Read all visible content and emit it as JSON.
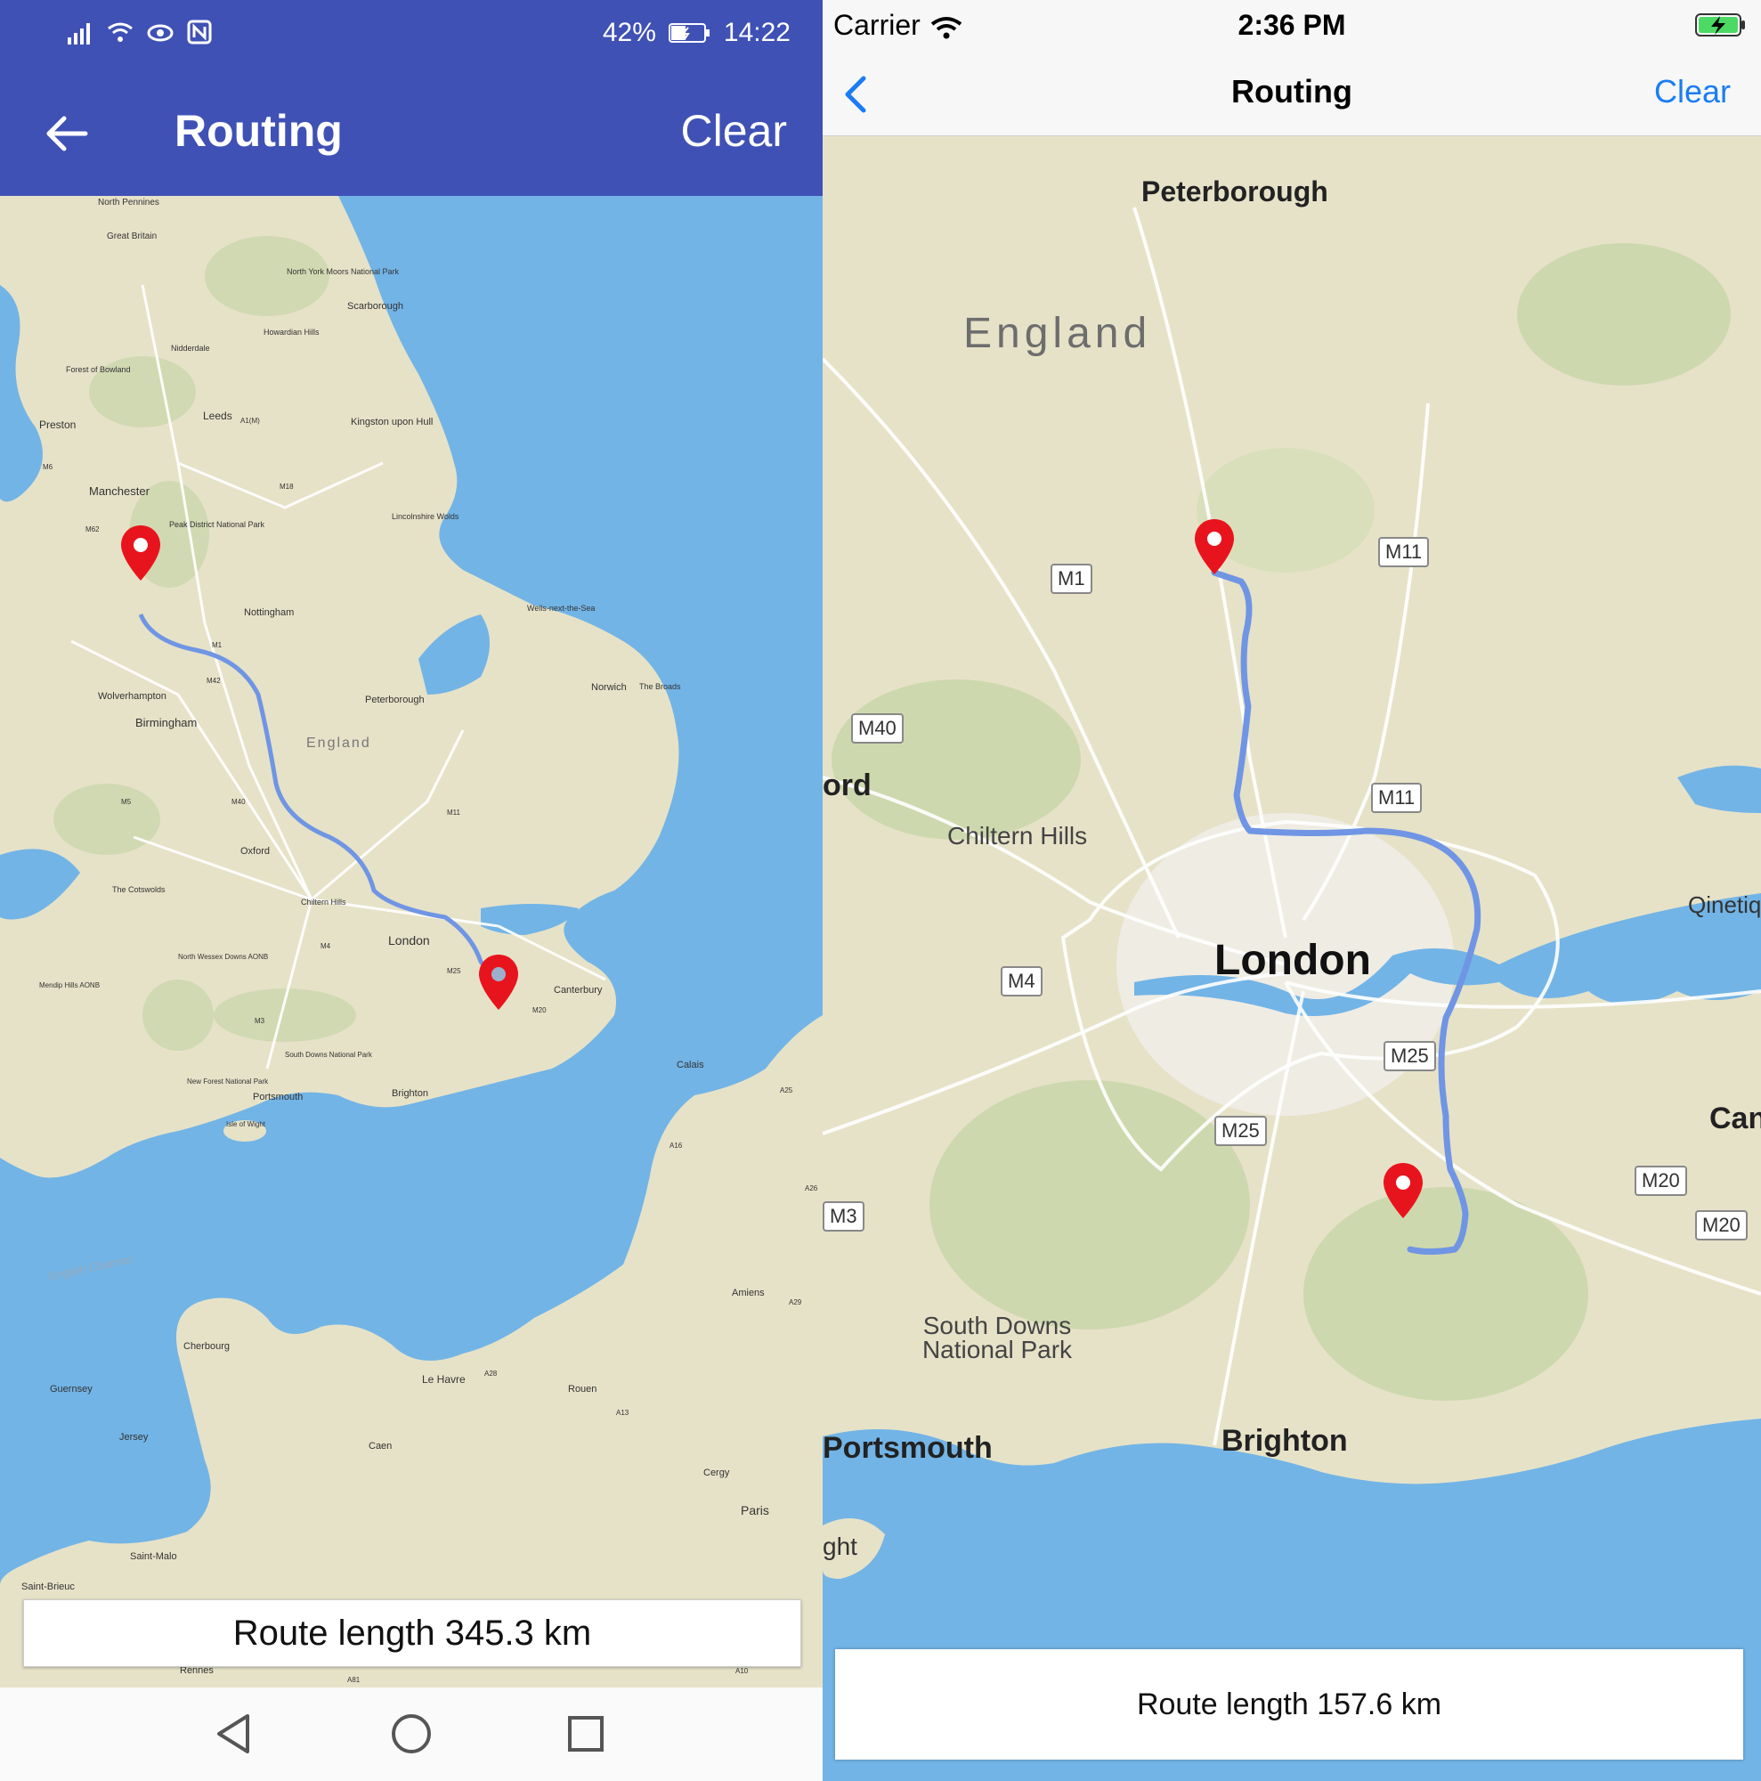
{
  "android": {
    "status": {
      "battery_pct": "42%",
      "time": "14:22"
    },
    "toolbar": {
      "title": "Routing",
      "clear_label": "Clear"
    },
    "route_length": "Route length 345.3 km",
    "map": {
      "places": [
        "North Pennines",
        "Great Britain",
        "North York Moors National Park",
        "Scarborough",
        "Howardian Hills",
        "Nidderdale",
        "Forest of Bowland",
        "Preston",
        "Leeds",
        "Kingston upon Hull",
        "Manchester",
        "Peak District National Park",
        "Lincolnshire Wolds",
        "Nottingham",
        "Wells-next-the-Sea",
        "Norwich",
        "The Broads",
        "Wolverhampton",
        "Birmingham",
        "Peterborough",
        "England",
        "Oxford",
        "The Cotswolds",
        "Chiltern Hills",
        "London",
        "North Wessex Downs AONB",
        "Mendip Hills AONB",
        "Canterbury",
        "South Downs National Park",
        "New Forest National Park",
        "Portsmouth",
        "Brighton",
        "Isle of Wight",
        "Calais",
        "English Channel",
        "Amiens",
        "Cherbourg",
        "Guernsey",
        "Jersey",
        "Le Havre",
        "Rouen",
        "Caen",
        "Cergy",
        "Paris",
        "Saint-Malo",
        "Saint-Brieuc",
        "Rennes"
      ],
      "roads": [
        "M6",
        "M62",
        "A1(M)",
        "M18",
        "M1",
        "M42",
        "M5",
        "M40",
        "M11",
        "M4",
        "M25",
        "M20",
        "M3",
        "A16",
        "A26",
        "A25",
        "A29",
        "A28",
        "A13",
        "A81",
        "A10"
      ]
    },
    "nav": {
      "icons": [
        "back-triangle-icon",
        "home-circle-icon",
        "recents-square-icon"
      ]
    }
  },
  "ios": {
    "status": {
      "carrier": "Carrier",
      "time": "2:36 PM"
    },
    "nav": {
      "title": "Routing",
      "clear_label": "Clear"
    },
    "route_length": "Route length 157.6 km",
    "map": {
      "places": [
        "Peterborough",
        "England",
        "ord",
        "Chiltern Hills",
        "London",
        "Qinetiq",
        "Can",
        "South Downs National Park",
        "Portsmouth",
        "Brighton",
        "ght"
      ],
      "roads": [
        "M1",
        "M11",
        "M40",
        "M11",
        "M4",
        "M25",
        "M25",
        "M20",
        "M20",
        "M3"
      ]
    }
  },
  "colors": {
    "android_primary": "#3f51b5",
    "ios_accent": "#1a7cf5",
    "route": "#6f95e4",
    "marker": "#e8141d",
    "sea": "#72b4e6",
    "land": "#e6e2c8"
  }
}
